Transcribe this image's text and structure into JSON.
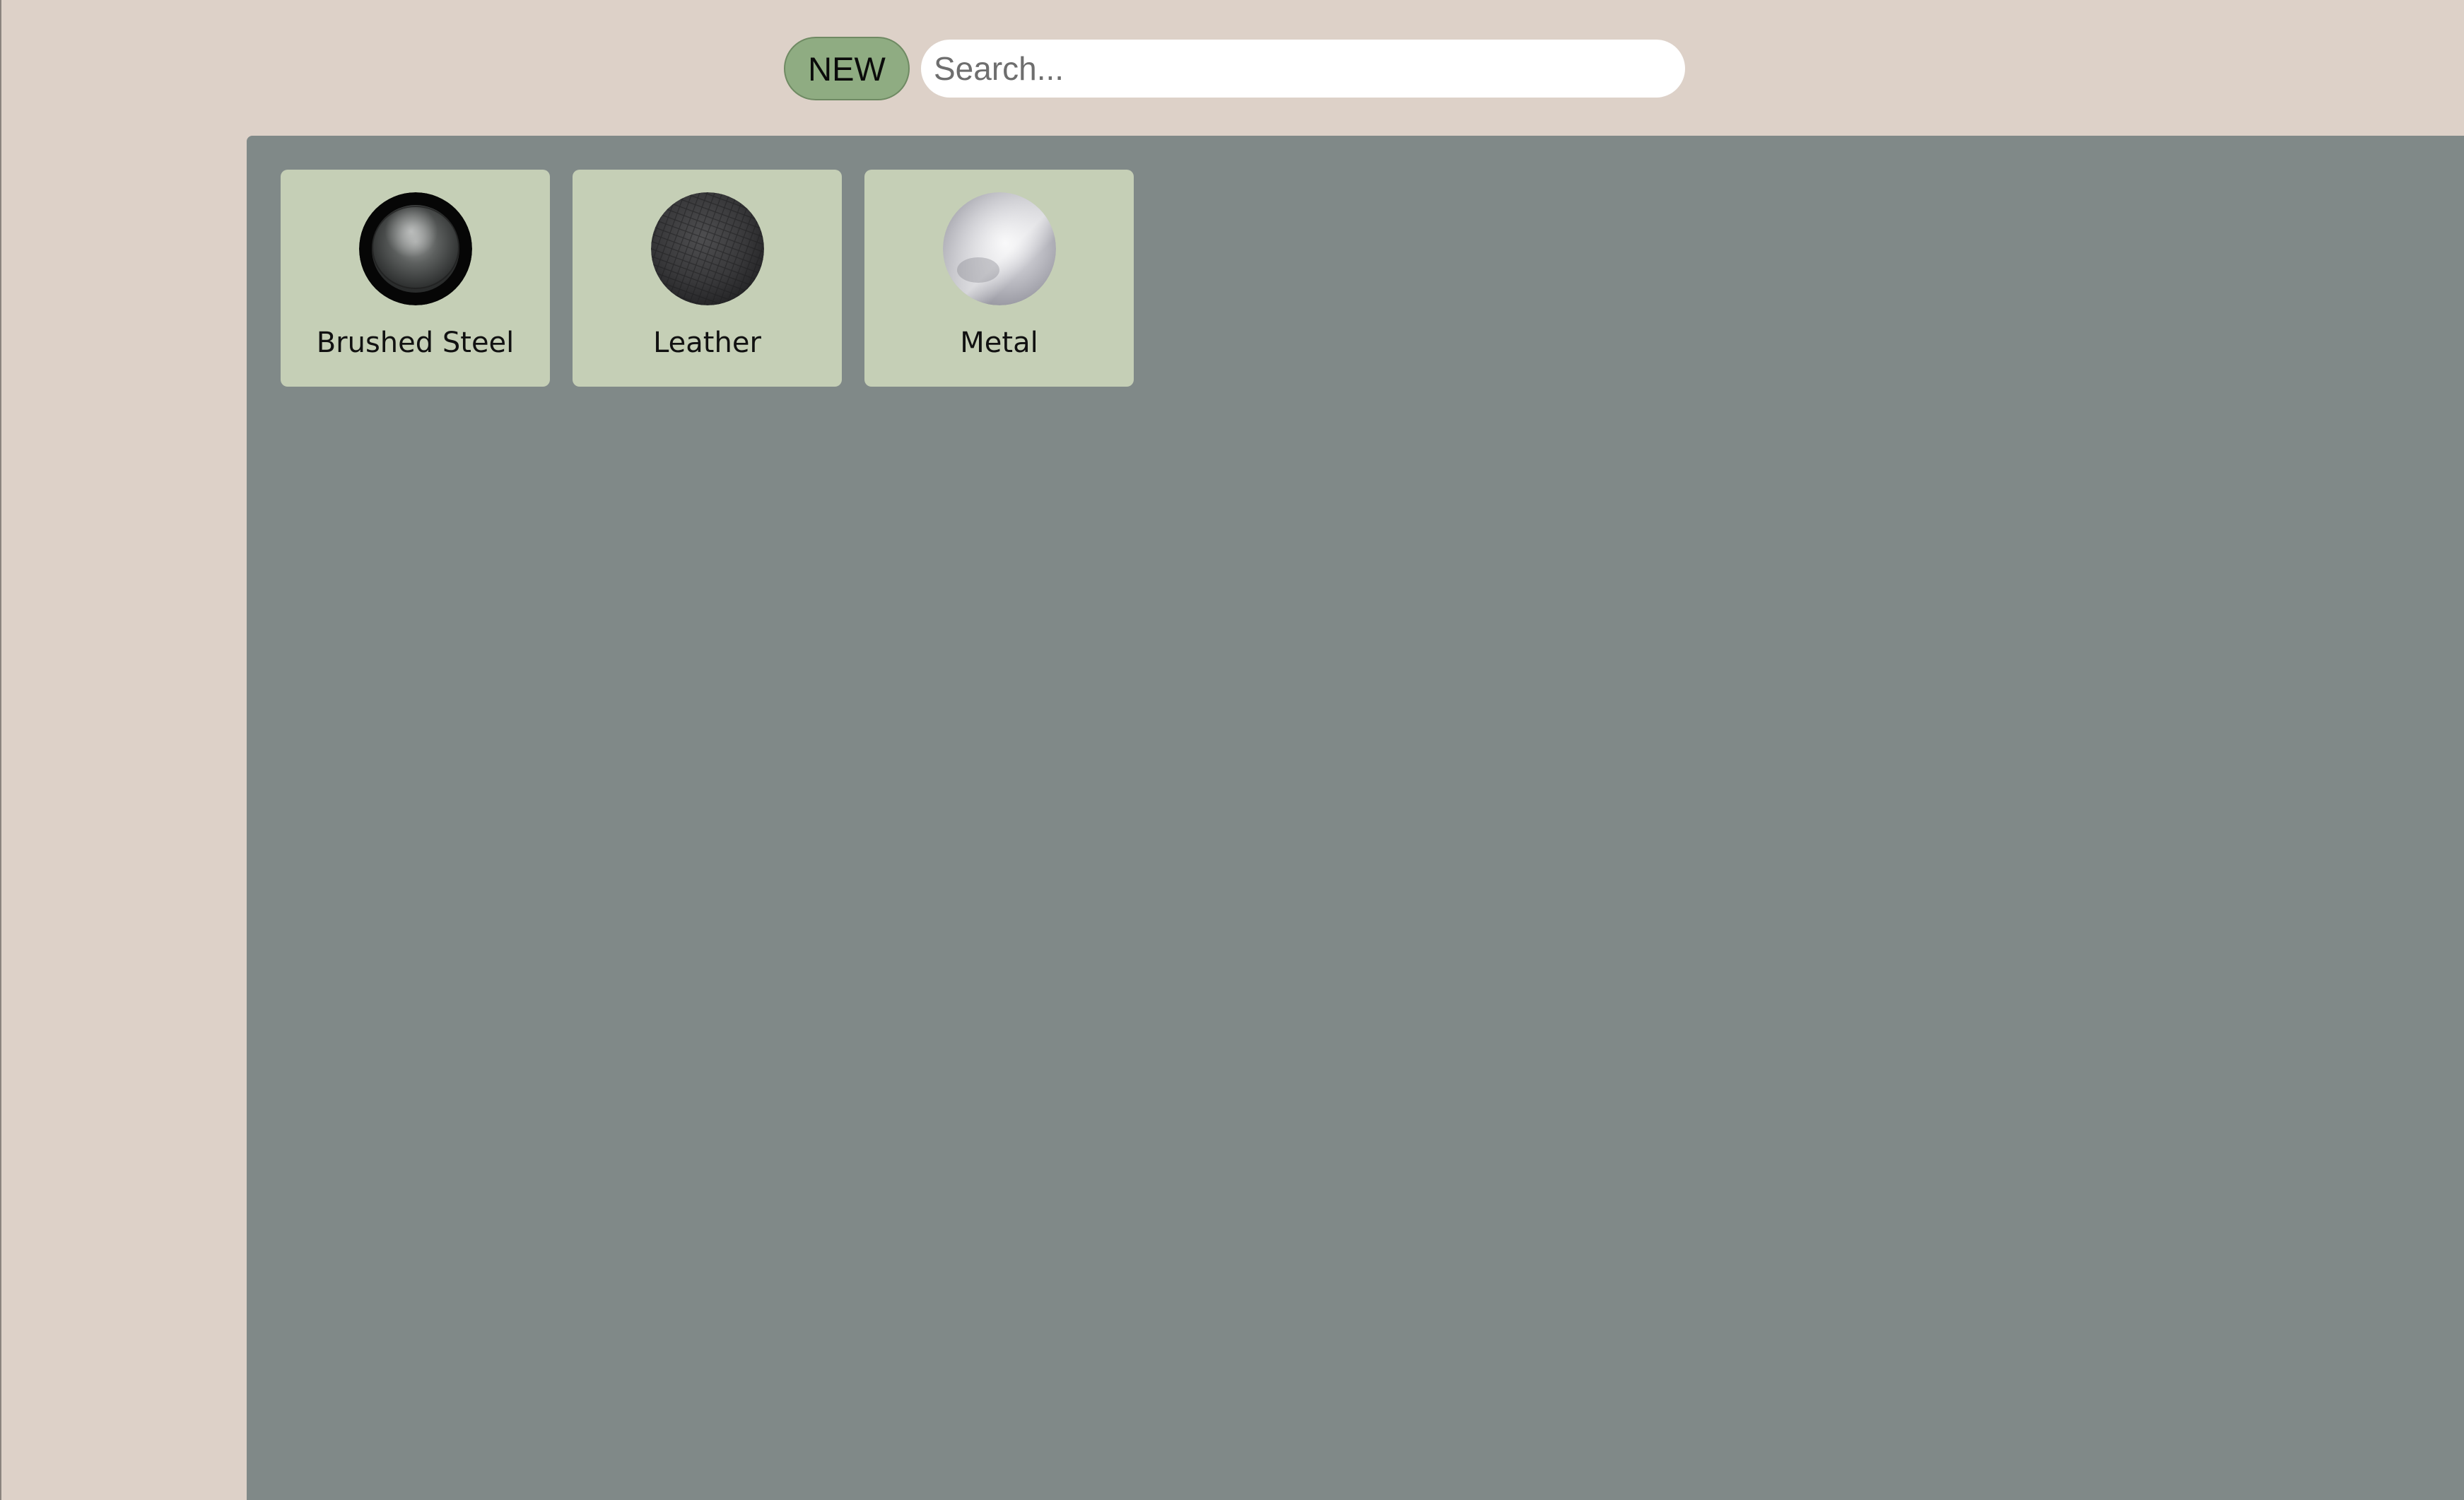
{
  "toolbar": {
    "new_label": "NEW",
    "search_placeholder": "Search..."
  },
  "materials": [
    {
      "label": "Brushed Steel",
      "icon": "brushed-steel-sphere-icon"
    },
    {
      "label": "Leather",
      "icon": "leather-sphere-icon"
    },
    {
      "label": "Metal",
      "icon": "metal-sphere-icon"
    }
  ],
  "colors": {
    "window_background": "#ddd1c8",
    "panel_background": "#808988",
    "card_background": "#c5cfb6",
    "new_button_background": "#8fac82"
  }
}
